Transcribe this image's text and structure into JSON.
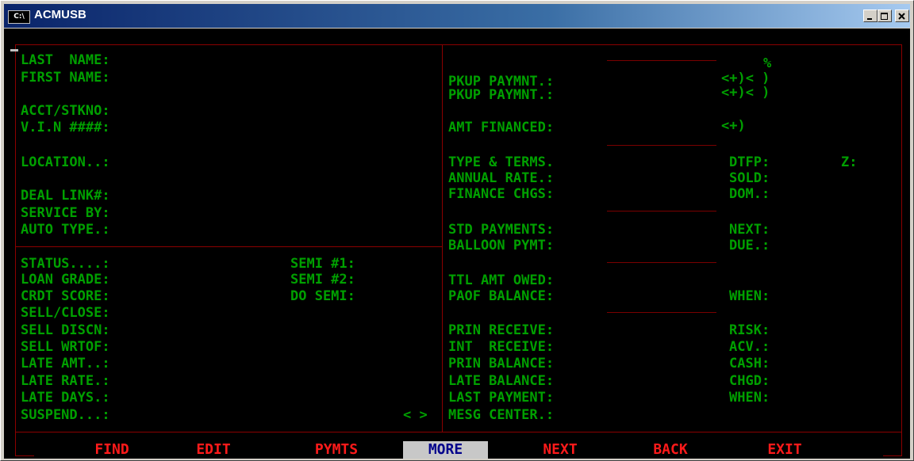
{
  "window": {
    "title": "ACMUSB",
    "icon_text": "C:\\"
  },
  "left_top": {
    "last_name": "LAST  NAME:",
    "first_name": "FIRST NAME:",
    "acct": "ACCT/STKNO:",
    "vin": "V.I.N ####:",
    "location": "LOCATION..:",
    "deal_link": "DEAL LINK#:",
    "service_by": "SERVICE BY:",
    "auto_type": "AUTO TYPE.:"
  },
  "left_bottom": {
    "status": "STATUS....:",
    "loan_grade": "LOAN GRADE:",
    "crdt_score": "CRDT SCORE:",
    "sell_close": "SELL/CLOSE:",
    "sell_discn": "SELL DISCN:",
    "sell_wrtof": "SELL WRTOF:",
    "late_amt": "LATE AMT..:",
    "late_rate": "LATE RATE.:",
    "late_days": "LATE DAYS.:",
    "suspend": "SUSPEND...:",
    "semi1": "SEMI #1:",
    "semi2": "SEMI #2:",
    "do_semi": "DO SEMI:",
    "suspend_flag": "< >"
  },
  "right": {
    "percent": "%",
    "pkup1": "PKUP PAYMNT.:",
    "pkup1_flag": "<+)< )",
    "pkup2": "PKUP PAYMNT.:",
    "pkup2_flag": "<+)< )",
    "amt_financed": "AMT FINANCED:",
    "amt_flag": "<+)",
    "type_terms": "TYPE & TERMS.",
    "annual_rate": "ANNUAL RATE.:",
    "finance_chgs": "FINANCE CHGS:",
    "dtfp": "DTFP:",
    "z": "Z:",
    "sold": "SOLD:",
    "dom": "DOM.:",
    "std_payments": "STD PAYMENTS:",
    "balloon_pymt": "BALLOON PYMT:",
    "next": "NEXT:",
    "due": "DUE.:",
    "ttl_amt_owed": "TTL AMT OWED:",
    "paof_balance": "PAOF BALANCE:",
    "when1": "WHEN:",
    "prin_receive": "PRIN RECEIVE:",
    "int_receive": "INT  RECEIVE:",
    "prin_balance": "PRIN BALANCE:",
    "late_balance": "LATE BALANCE:",
    "last_payment": "LAST PAYMENT:",
    "mesg_center": "MESG CENTER.:",
    "risk": "RISK:",
    "acv": "ACV.:",
    "cash": "CASH:",
    "chgd": "CHGD:",
    "when2": "WHEN:"
  },
  "menu": {
    "find": "FIND",
    "edit": "EDIT",
    "pymts": "PYMTS",
    "more": "MORE",
    "next": "NEXT",
    "back": "BACK",
    "exit": "EXIT"
  },
  "colors": {
    "label": "#00a000",
    "border": "#8b0000",
    "menu": "#ff1a1a",
    "menu_selected_bg": "#c8c8c8",
    "menu_selected_fg": "#00008b"
  }
}
